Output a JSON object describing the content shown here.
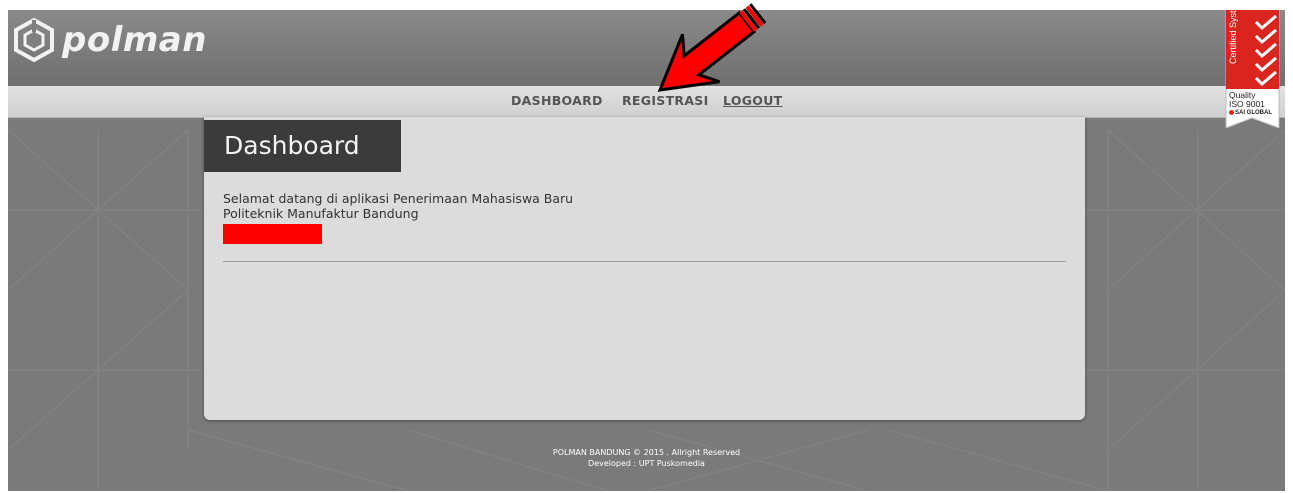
{
  "brand": {
    "logo_icon": "polman-hexagon-logo",
    "logo_text": "polman"
  },
  "nav": {
    "items": [
      {
        "label": "DASHBOARD"
      },
      {
        "label": "REGISTRASI"
      },
      {
        "label": "LOGOUT"
      }
    ]
  },
  "panel": {
    "title": "Dashboard",
    "welcome_line1": "Selamat datang di aplikasi Penerimaan Mahasiswa Baru",
    "welcome_line2": "Politeknik Manufaktur Bandung"
  },
  "footer": {
    "line1": "POLMAN BANDUNG © 2015 . Allright Reserved",
    "line2": "Developed : UPT Puskomedia"
  },
  "badge": {
    "vertical_text": "Certified System",
    "line1": "Quality",
    "line2": "ISO 9001",
    "org": "SAI GLOBAL"
  },
  "annotation": {
    "arrow_icon": "red-arrow-icon",
    "arrow_color": "#ff0000",
    "redaction_color": "#ff0000"
  },
  "colors": {
    "header": "#7a7a7a",
    "navbar": "#d8d8d8",
    "panel": "#dcdcdc",
    "panel_tab": "#3b3b3b",
    "badge_red": "#d9251d"
  }
}
